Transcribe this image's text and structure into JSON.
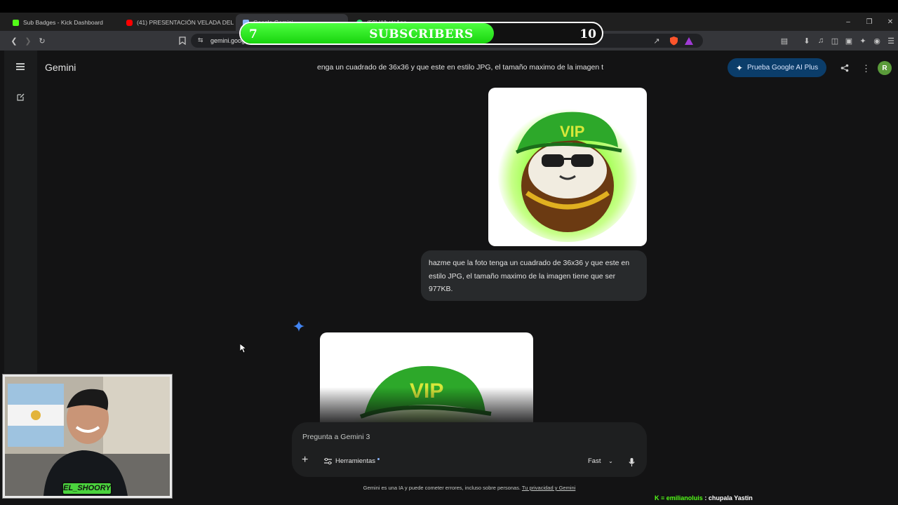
{
  "browser": {
    "tabs": [
      {
        "label": "Sub Badges - Kick Dashboard",
        "favicon_color": "#53fc18",
        "active": false
      },
      {
        "label": "(41) PRESENTACIÓN VELADA DEL AÑ",
        "favicon_color": "#ff0000",
        "active": false
      },
      {
        "label": "Google Gemini",
        "favicon_color": "#8ab4f8",
        "active": true
      },
      {
        "label": "(59) WhatsApp",
        "favicon_color": "#25d366",
        "active": false
      }
    ],
    "url": "gemini.google.com/app",
    "brave_badge_count": "2",
    "rewards_badge_count": "1"
  },
  "overlay": {
    "subs_current": "7",
    "subs_goal": "10",
    "subs_label": "SUBSCRIBERS",
    "subs_progress": 0.7,
    "subs_color": "#32e827"
  },
  "gemini": {
    "brand": "Gemini",
    "chat_title": "enga un cuadrado de 36x36 y que este en estilo JPG, el tamaño maximo de la imagen t",
    "upgrade_label": "Prueba Google AI Plus",
    "avatar_letter": "R",
    "avatar_color": "#5a9b3a",
    "user_message": "hazme que la foto tenga un cuadrado de 36x36 y que este en estilo JPG, el tamaño maximo de la imagen tiene que ser 977KB.",
    "image_text": "VIP",
    "composer": {
      "placeholder": "Pregunta a Gemini 3",
      "tools_label": "Herramientas",
      "model_label": "Fast"
    },
    "disclaimer": "Gemini es una IA y puede cometer errores, incluso sobre personas.",
    "privacy_link": "Tu privacidad y Gemini",
    "accent_color": "#4285f4"
  },
  "stream": {
    "streamer_name": "EL_SHOORY",
    "chat_user": "emilianoluis",
    "chat_message": "chupala Yastin",
    "kick_color": "#53fc18"
  },
  "icons": [
    "back-icon",
    "forward-icon",
    "reload-icon",
    "bookmark-icon",
    "site-info-icon",
    "share-icon",
    "brave-shield-icon",
    "brave-rewards-icon",
    "download-icon",
    "media-icon",
    "sidebar-icon",
    "wallet-icon",
    "leo-icon",
    "vpn-icon",
    "menu-icon",
    "new-chat-icon",
    "sparkle-icon",
    "add-icon",
    "tools-icon",
    "mic-icon",
    "kick-icon"
  ]
}
